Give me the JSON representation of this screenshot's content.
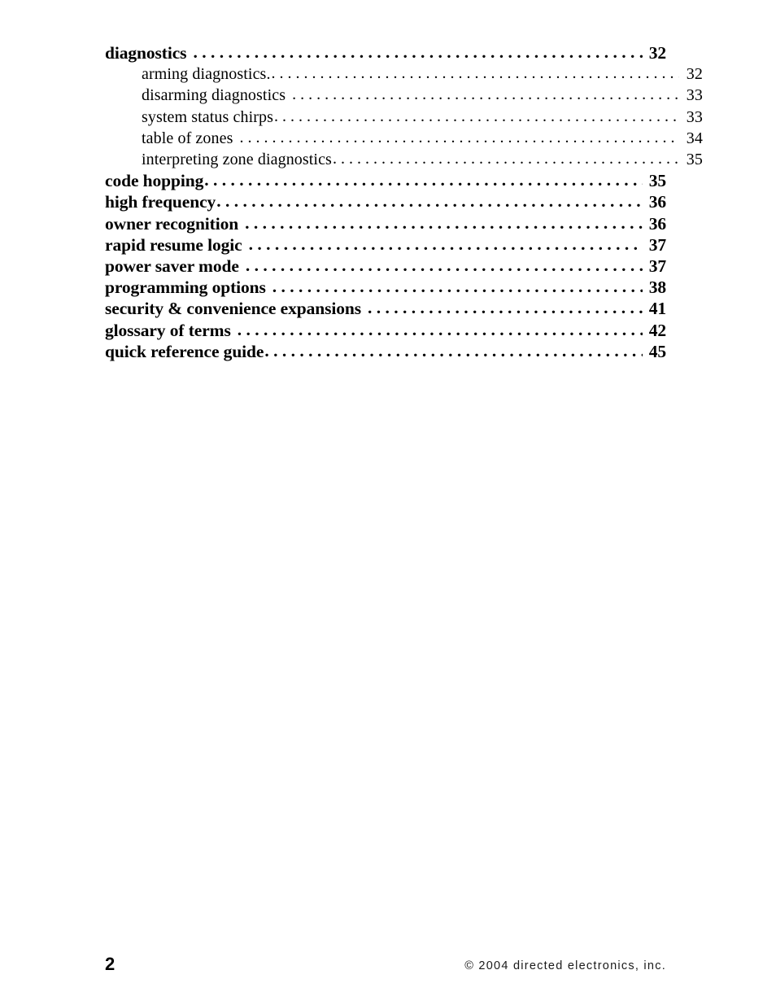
{
  "document": {
    "type": "table-of-contents",
    "page_label": "2",
    "copyright": "© 2004 directed electronics, inc."
  },
  "toc": {
    "entries": [
      {
        "title": "diagnostics",
        "page": "32",
        "level": 1,
        "gap": true
      },
      {
        "title": "arming diagnostics.",
        "page": "32",
        "level": 2,
        "gap": false
      },
      {
        "title": "disarming diagnostics",
        "page": "33",
        "level": 2,
        "gap": true
      },
      {
        "title": "system status chirps",
        "page": "33",
        "level": 2,
        "gap": false
      },
      {
        "title": "table of zones",
        "page": "34",
        "level": 2,
        "gap": true
      },
      {
        "title": "interpreting zone diagnostics",
        "page": "35",
        "level": 2,
        "gap": false
      },
      {
        "title": "code hopping",
        "page": "35",
        "level": 1,
        "gap": false
      },
      {
        "title": "high frequency",
        "page": "36",
        "level": 1,
        "gap": false
      },
      {
        "title": "owner recognition",
        "page": "36",
        "level": 1,
        "gap": true
      },
      {
        "title": "rapid resume logic",
        "page": "37",
        "level": 1,
        "gap": true
      },
      {
        "title": "power saver mode",
        "page": "37",
        "level": 1,
        "gap": true
      },
      {
        "title": "programming options",
        "page": "38",
        "level": 1,
        "gap": true
      },
      {
        "title": "security & convenience expansions",
        "page": "41",
        "level": 1,
        "gap": true
      },
      {
        "title": "glossary of terms",
        "page": "42",
        "level": 1,
        "gap": true
      },
      {
        "title": "quick reference guide",
        "page": "45",
        "level": 1,
        "gap": false
      }
    ]
  }
}
